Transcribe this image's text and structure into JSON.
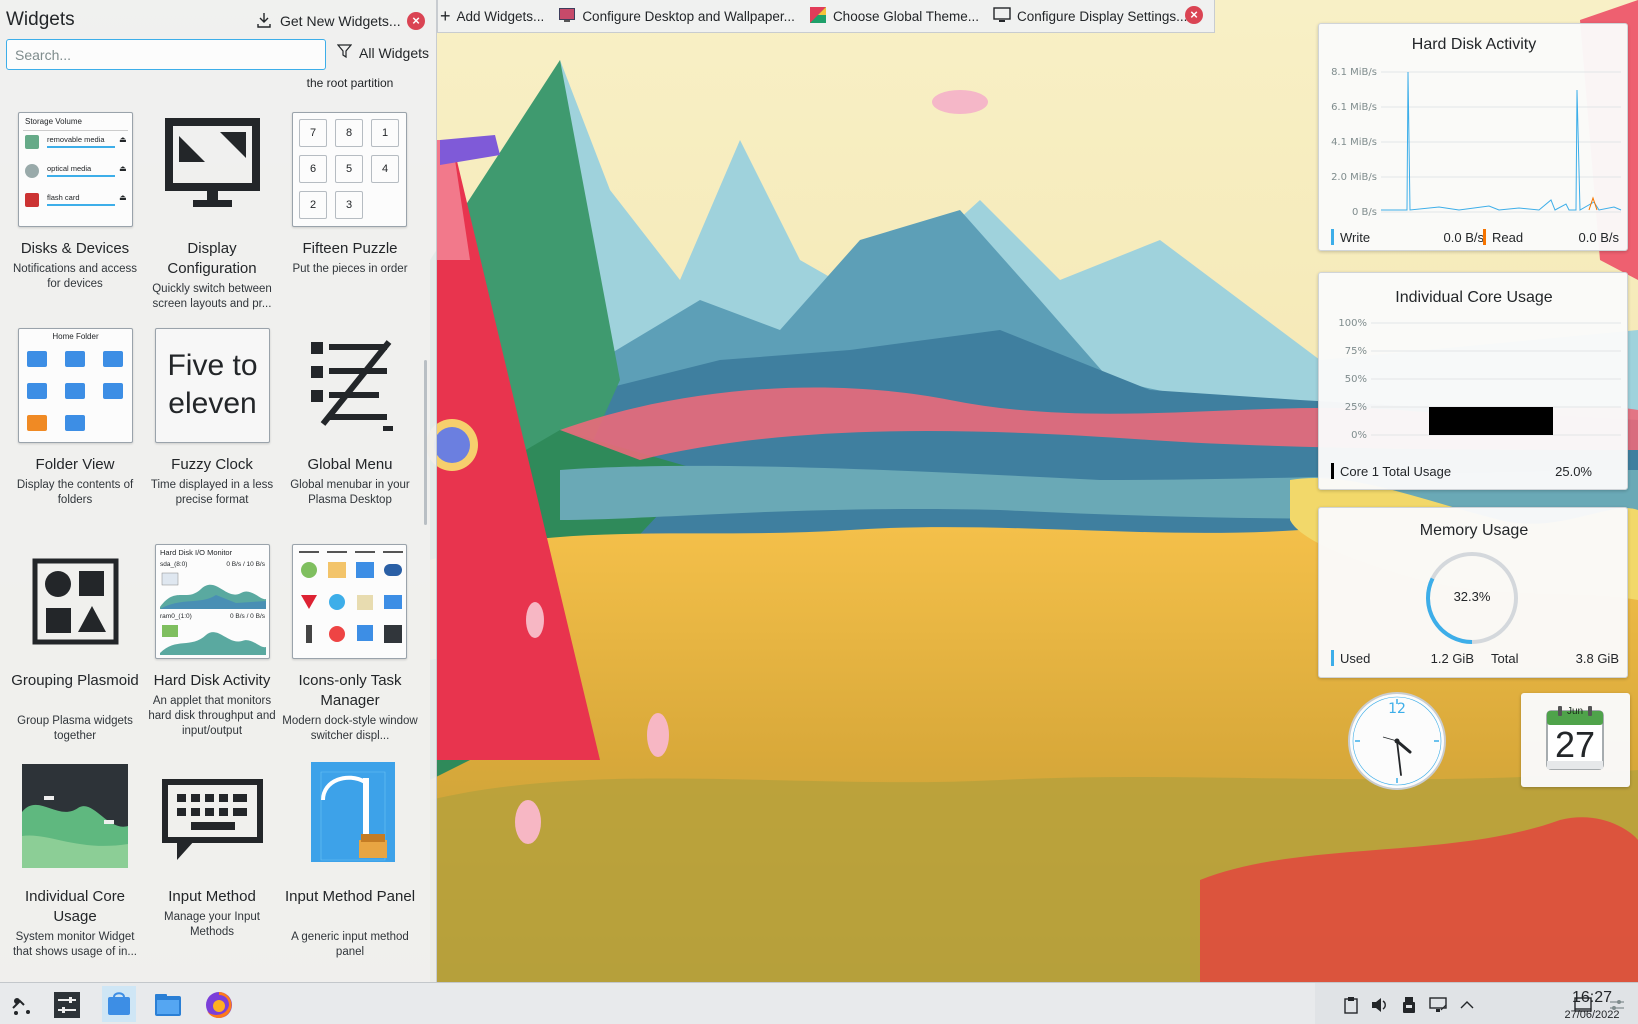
{
  "explorer": {
    "title": "Widgets",
    "get_new_label": "Get New Widgets...",
    "search_placeholder": "Search...",
    "filter_label": "All Widgets",
    "cut_off_text": "the root partition",
    "widgets": [
      {
        "name": "Disks & Devices",
        "desc": "Notifications and access for devices"
      },
      {
        "name": "Display Configuration",
        "desc": "Quickly switch between screen layouts and pr..."
      },
      {
        "name": "Fifteen Puzzle",
        "desc": "Put the pieces in order"
      },
      {
        "name": "Folder View",
        "desc": "Display the contents of folders"
      },
      {
        "name": "Fuzzy Clock",
        "desc": "Time displayed in a less precise format"
      },
      {
        "name": "Global Menu",
        "desc": "Global menubar in your Plasma Desktop"
      },
      {
        "name": "Grouping Plasmoid",
        "desc": "Group Plasma widgets together"
      },
      {
        "name": "Hard Disk Activity",
        "desc": "An applet that monitors hard disk throughput and input/output"
      },
      {
        "name": "Icons-only Task Manager",
        "desc": "Modern dock-style window switcher displ..."
      },
      {
        "name": "Individual Core Usage",
        "desc": "System monitor Widget that shows usage of in..."
      },
      {
        "name": "Input Method",
        "desc": "Manage your Input Methods"
      },
      {
        "name": "Input Method Panel",
        "desc": "A generic input method panel"
      }
    ],
    "thumbs": {
      "storage_title": "Storage Volume",
      "storage_items": [
        "removable media",
        "optical media",
        "flash card"
      ],
      "puzzle_tiles": [
        "7",
        "8",
        "1",
        "6",
        "5",
        "4",
        "2",
        "3"
      ],
      "folder_title": "Home Folder",
      "fuzzy_text_1": "Five to",
      "fuzzy_text_2": "eleven",
      "hdd_title": "Hard Disk I/O Monitor",
      "hdd_row1": "sda_(8:0)",
      "hdd_row1_val": "0 B/s / 10 B/s",
      "hdd_row2": "ram0_(1:0)",
      "hdd_row2_val": "0 B/s / 0 B/s"
    }
  },
  "toolbar": {
    "items": [
      "Add Widgets...",
      "Configure Desktop and Wallpaper...",
      "Choose Global Theme...",
      "Configure Display Settings..."
    ]
  },
  "hdd_widget": {
    "title": "Hard Disk Activity",
    "y_ticks": [
      "8.1 MiB/s",
      "6.1 MiB/s",
      "4.1 MiB/s",
      "2.0 MiB/s",
      "0 B/s"
    ],
    "write_label": "Write",
    "write_value": "0.0 B/s",
    "read_label": "Read",
    "read_value": "0.0 B/s",
    "write_color": "#3daee9",
    "read_color": "#f67400"
  },
  "core_widget": {
    "title": "Individual Core Usage",
    "y_ticks": [
      "100%",
      "75%",
      "50%",
      "25%",
      "0%"
    ],
    "legend_label": "Core 1 Total Usage",
    "legend_value": "25.0%",
    "usage_fraction": 0.25,
    "bar_color": "#000000"
  },
  "memory_widget": {
    "title": "Memory Usage",
    "percent_text": "32.3%",
    "fraction": 0.323,
    "used_label": "Used",
    "used_value": "1.2 GiB",
    "total_label": "Total",
    "total_value": "3.8 GiB",
    "arc_color": "#3daee9"
  },
  "clock": {
    "twelve": "12"
  },
  "calendar": {
    "month": "Jun",
    "day": "27"
  },
  "taskbar": {
    "time": "16:27",
    "date": "27/06/2022"
  }
}
